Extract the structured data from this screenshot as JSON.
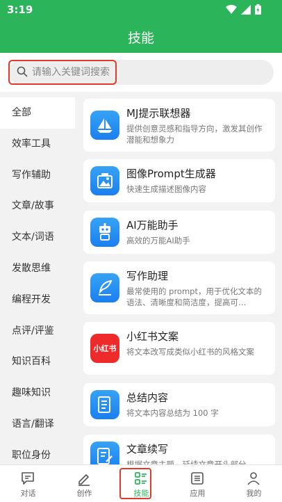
{
  "status": {
    "time": "3:19"
  },
  "header": {
    "title": "技能"
  },
  "search": {
    "placeholder": "请输入关键词搜索"
  },
  "sidebar": {
    "items": [
      {
        "label": "全部"
      },
      {
        "label": "效率工具"
      },
      {
        "label": "写作辅助"
      },
      {
        "label": "文章/故事"
      },
      {
        "label": "文本/词语"
      },
      {
        "label": "发散思维"
      },
      {
        "label": "编程开发"
      },
      {
        "label": "点评/评鉴"
      },
      {
        "label": "知识百科"
      },
      {
        "label": "趣味知识"
      },
      {
        "label": "语言/翻译"
      },
      {
        "label": "职位身份"
      }
    ]
  },
  "skills": [
    {
      "name": "MJ提示联想器",
      "desc": "提供创意灵感和指导方向，激发其创作潜能和想象力",
      "icon": "sailboat-icon"
    },
    {
      "name": "图像Prompt生成器",
      "desc": "快速生成描述图像内容",
      "icon": "image-frame-icon"
    },
    {
      "name": "AI万能助手",
      "desc": "高效的万能AI助手",
      "icon": "robot-icon"
    },
    {
      "name": "写作助理",
      "desc": "最常使用的 prompt，用于优化文本的语法、清晰度和简洁度，提高可…",
      "icon": "feather-icon"
    },
    {
      "name": "小红书文案",
      "desc": "将文本改写成类似小红书的风格文案",
      "icon": "xiaohongshu-logo-icon",
      "logo_text": "小红书"
    },
    {
      "name": "总结内容",
      "desc": "将文本内容总结为 100 字",
      "icon": "document-icon"
    },
    {
      "name": "文章续写",
      "desc": "根据文章主题，延续文章开头部分",
      "icon": "edit-document-icon"
    }
  ],
  "tabs": [
    {
      "label": "对话",
      "icon": "chat-icon"
    },
    {
      "label": "创作",
      "icon": "pen-icon"
    },
    {
      "label": "技能",
      "icon": "skills-grid-icon"
    },
    {
      "label": "应用",
      "icon": "list-icon"
    },
    {
      "label": "我的",
      "icon": "person-icon"
    }
  ],
  "colors": {
    "primary": "#2bb45a",
    "highlight": "#e03a2a",
    "icon_blue": "#1a7ff0",
    "icon_red": "#ef2a2a"
  }
}
